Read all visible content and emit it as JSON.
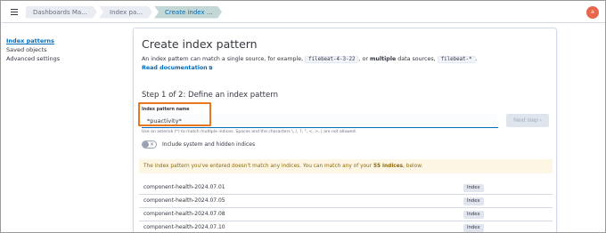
{
  "breadcrumbs": [
    "Dashboards Ma...",
    "Index patterns",
    "Create index pattern"
  ],
  "avatar": {
    "initial": "a",
    "color": "#e7664c"
  },
  "sidebar": {
    "items": [
      {
        "label": "Index patterns",
        "active": true
      },
      {
        "label": "Saved objects",
        "active": false
      },
      {
        "label": "Advanced settings",
        "active": false
      }
    ]
  },
  "main": {
    "title": "Create index pattern",
    "desc_part1": "An index pattern can match a single source, for example,",
    "example1": "filebeat-4-3-22",
    "desc_part2": ", or",
    "desc_bold": "multiple",
    "desc_part3": "data sources,",
    "example2": "filebeat-*",
    "desc_end": ".",
    "read_doc_label": "Read documentation",
    "step_title": "Step 1 of 2: Define an index pattern",
    "field_label": "Index pattern name",
    "input_value": "*puactivity*",
    "next_button": "Next step",
    "help_text": "Use an asterisk (*) to match multiple indices. Spaces and the characters \\, /, ?, \", <, >, | are not allowed.",
    "toggle_label": "Include system and hidden indices",
    "callout_part1": "The index pattern you've entered doesn't match any indices. You can match any of your",
    "callout_bold": "55 indices",
    "callout_part2": ", below.",
    "indices": [
      {
        "name": "component-health-2024.07.01",
        "badge": "Index"
      },
      {
        "name": "component-health-2024.07.05",
        "badge": "Index"
      },
      {
        "name": "component-health-2024.07.08",
        "badge": "Index"
      },
      {
        "name": "component-health-2024.07.10",
        "badge": "Index"
      }
    ]
  },
  "colors": {
    "accent": "#006bb8",
    "highlight_box": "#e87722",
    "callout_bg": "#fef6e5"
  }
}
